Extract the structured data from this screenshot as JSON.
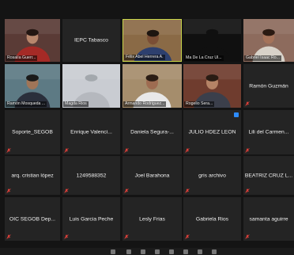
{
  "meeting": {
    "participants": [
      {
        "name": "Rosalía Guerr...",
        "video": true,
        "muted": false,
        "bg": "#5a3b36",
        "skin": "#b7866c",
        "hair": "#231612",
        "shirt": "#a52a26"
      },
      {
        "name": "IEPC Tabasco",
        "video": false,
        "muted": false
      },
      {
        "name": "Félix Abel Herrera A.",
        "video": true,
        "muted": false,
        "active": true,
        "bg": "#8a6a46",
        "skin": "#7a4e35",
        "hair": "#1d1510",
        "shirt": "#2d3f6e"
      },
      {
        "name": "Ma De La Cruz  Ul...",
        "video": true,
        "muted": false,
        "bg": "#101010",
        "skin": "#101010",
        "hair": "#101010",
        "shirt": "#101010"
      },
      {
        "name": "Gabriel Isaac Ro...",
        "video": true,
        "muted": false,
        "bg": "#8d6b5d",
        "skin": "#a5735a",
        "hair": "#2a1a12",
        "shirt": "#d8d2c9"
      },
      {
        "name": "Ramón Mosqueda ...",
        "video": true,
        "muted": false,
        "bg": "#5d7a84",
        "skin": "#a07558",
        "hair": "#1a1a1a",
        "shirt": "#2a2f3b"
      },
      {
        "name": "Magda Rios",
        "video": true,
        "muted": false,
        "bg": "#c9ccd2",
        "skin": "#c9ccd2",
        "hair": "#a3a8ad",
        "shirt": "#b5b8be"
      },
      {
        "name": "Armando Rodriguez...",
        "video": true,
        "muted": false,
        "bg": "#a58d6c",
        "skin": "#9e6c51",
        "hair": "#2b1d15",
        "shirt": "#e8e8e8"
      },
      {
        "name": "Rogelio Sera...",
        "video": true,
        "muted": false,
        "bg": "#6f3c2e",
        "skin": "#b58366",
        "hair": "#2a1c14",
        "shirt": "#3b3f4b"
      },
      {
        "name": "Ramón Guzmán",
        "video": false,
        "muted": true
      },
      {
        "name": "Soporte_SEGOB",
        "video": false,
        "muted": true
      },
      {
        "name": "Enrique  Valenci...",
        "video": false,
        "muted": true
      },
      {
        "name": "Daniela  Segura-...",
        "video": false,
        "muted": true
      },
      {
        "name": "JULIO HDEZ LEON",
        "video": false,
        "muted": true,
        "badge": true
      },
      {
        "name": "Lili del Carmen...",
        "video": false,
        "muted": true
      },
      {
        "name": "arq. cristian lópez",
        "video": false,
        "muted": true
      },
      {
        "name": "1249588352",
        "video": false,
        "muted": true
      },
      {
        "name": "Joel Barahona",
        "video": false,
        "muted": true
      },
      {
        "name": "gris archivo",
        "video": false,
        "muted": true
      },
      {
        "name": "BEATRIZ CRUZ L...",
        "video": false,
        "muted": true
      },
      {
        "name": "OIC SEGOB  Dep...",
        "video": false,
        "muted": true
      },
      {
        "name": "Luis Garcia Peche",
        "video": false,
        "muted": true
      },
      {
        "name": "Lesly Frias",
        "video": false,
        "muted": true
      },
      {
        "name": "Gabriela Rios",
        "video": false,
        "muted": true
      },
      {
        "name": "samanta aguirre",
        "video": false,
        "muted": true
      }
    ],
    "colors": {
      "muted_icon": "#e0403a",
      "active_border": "#c9d64a",
      "tile_bg": "#242424",
      "badge": "#2d8cff"
    },
    "toolbar_icons": [
      "mic-icon",
      "video-icon",
      "security-icon",
      "participants-icon",
      "chat-icon",
      "share-icon",
      "record-icon",
      "reactions-icon"
    ]
  }
}
